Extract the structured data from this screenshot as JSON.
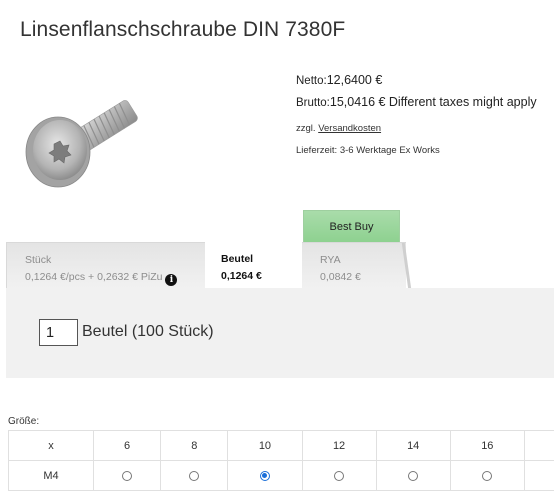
{
  "product": {
    "title": "Linsenflanschschraube DIN 7380F",
    "image_icon": "screw-image"
  },
  "pricing": {
    "netto_label": "Netto:",
    "netto_value": "12,6400 €",
    "brutto_label": "Brutto:",
    "brutto_value": "15,0416 €",
    "tax_note": "Different taxes might apply",
    "shipping_prefix": "zzgl.",
    "shipping_link": "Versandkosten",
    "delivery": "Lieferzeit: 3-6 Werktage Ex Works"
  },
  "tabs": {
    "badge": "Best Buy",
    "items": [
      {
        "name": "Stück",
        "price": "0,1264 €/pcs + 0,2632 € PiZu",
        "info_icon": "info-icon",
        "active": false
      },
      {
        "name": "Beutel",
        "price": "0,1264 €",
        "active": true
      },
      {
        "name": "RYA",
        "price": "0,0842 €",
        "active": false
      }
    ]
  },
  "quantity": {
    "value": "1",
    "unit": "Beutel (100 Stück)"
  },
  "sizes": {
    "label": "Größe:",
    "header": [
      "x",
      "6",
      "8",
      "10",
      "12",
      "14",
      "16"
    ],
    "rows": [
      {
        "label": "M4",
        "selected": "10"
      }
    ]
  },
  "colors": {
    "best_buy_bg": "#8ed190",
    "panel_bg": "#f1f1f1",
    "radio_selected": "#1a6ed8"
  }
}
